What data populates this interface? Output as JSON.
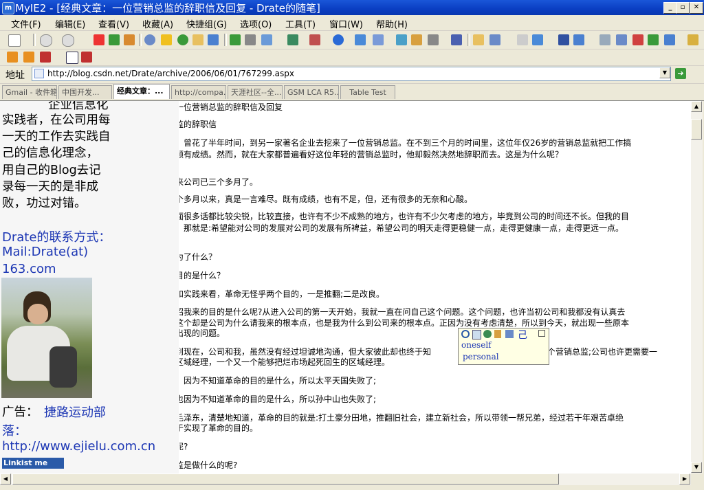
{
  "window": {
    "title": "MyIE2 - [经典文章：一位营销总监的辞职信及回复 - Drate的随笔]",
    "icon_glyph": "m",
    "min_glyph": "_",
    "restore_glyph": "▫",
    "close_glyph": "✕"
  },
  "menu": [
    "文件(F)",
    "编辑(E)",
    "查看(V)",
    "收藏(A)",
    "快捷组(G)",
    "选项(O)",
    "工具(T)",
    "窗口(W)",
    "帮助(H)"
  ],
  "address": {
    "label": "地址",
    "url": "http://blog.csdn.net/Drate/archive/2006/06/01/767299.aspx"
  },
  "tabs": [
    {
      "label": "Gmail - 收件箱",
      "active": false
    },
    {
      "label": "中国开发...",
      "active": false
    },
    {
      "label": "经典文章：...",
      "active": true
    },
    {
      "label": "http://compa...",
      "active": false
    },
    {
      "label": "天涯社区--全...",
      "active": false
    },
    {
      "label": "GSM LCA R5...",
      "active": false
    },
    {
      "label": "Table Test",
      "active": false
    }
  ],
  "left_panel": {
    "lines": [
      "企业信息化",
      "实践者，在公司用每",
      "一天的工作去实践自",
      "己的信息化理念，",
      "用自己的Blog去记",
      "录每一天的是非成",
      "败，功过对错。"
    ],
    "contact_lines": [
      "Drate的联系方式：",
      "Mail:Drate(at)",
      "163.com"
    ],
    "ad_label": "广告：",
    "ad_link": "捷路运动部",
    "ad_link2": "落：",
    "ad_url": "http://www.ejielu.com.cn",
    "badge": "Linkist me"
  },
  "article": {
    "lines": [
      "一位营销总监的辞职信及回复",
      "监的辞职信",
      "，曾花了半年时间，到另一家著名企业去挖来了一位营销总监。在不到三个月的时间里，这位年仅26岁的营销总监就把工作搞",
      "颇有成绩。然而，就在大家都普遍看好这位年轻的营销总监时，他却毅然决然地辞职而去。这是为什么呢？",
      "来公司已三个多月了。",
      "个多月以来，真是一言难尽。既有成绩，也有不足，但，还有很多的无奈和心酸。",
      "面很多话都比较尖锐，比较直接，也许有不少不成熟的地方，也许有不少欠考虑的地方，毕竟到公司的时间还不长。但我的目",
      "，那就是:希望能对公司的发展对公司的发展有所裨益，希望公司的明天走得更稳健一点，走得更健康一点，走得更远一点。",
      "为了什么？",
      "目的是什么？",
      "和实践来看，革命无怪乎两个目的，一是推翻;二是改良。",
      "招我来的目的是什么呢?从进入公司的第一天开始，我就一直在问自己这个问题。这个问题，也许当初公司和我都没有认真去",
      "这个却是公司为什么请我来的根本点，也是我为什么到公司来的根本点。正因为没有考虑清楚，所以到今天，就出现一些原本",
      "出现的问题。",
      "到现在，公司和我，虽然没有经过坦诚地沟通，但大家彼此却也终于知",
      "个营销总监;公司也许更需要一",
      "区域经理，一个又一个能够把烂市场起死回生的区域经理。",
      "，因为不知道革命的目的是什么，所以太平天国失败了;",
      "也因为不知道革命的目的是什么，所以孙中山也失败了;",
      "毛泽东，清楚地知道，革命的目的就是:打土豪分田地，推翻旧社会，建立新社会，所以带领一帮兄弟，经过若干年艰苦卓绝",
      "于实现了革命的目的。",
      "呢?",
      "监是做什么的呢?"
    ]
  },
  "dict_popup": {
    "headword": "己",
    "meanings": [
      "oneself",
      "personal"
    ]
  },
  "colors": {
    "titlebar": "#0a3ec2",
    "link_blue": "#1d37b4",
    "popup_bg": "#ffffe4"
  }
}
